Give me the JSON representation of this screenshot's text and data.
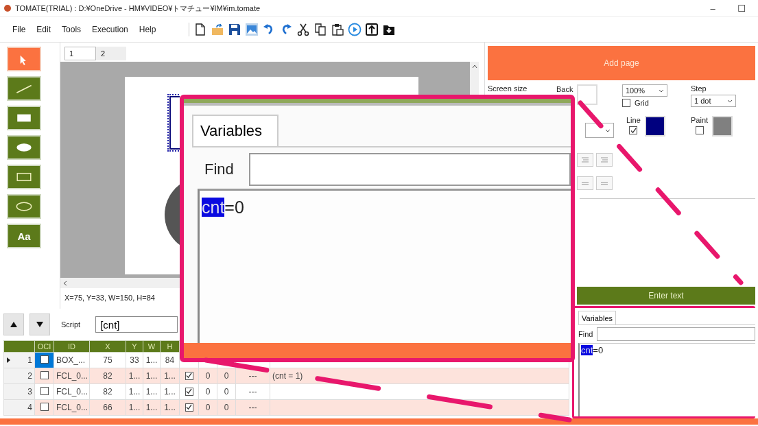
{
  "window": {
    "title": "TOMATE(TRIAL) : D:¥OneDrive - HM¥VIDEO¥トマチュー¥IM¥im.tomate",
    "controls": [
      "–",
      "☐"
    ]
  },
  "menu": [
    "File",
    "Edit",
    "Tools",
    "Execution",
    "Help"
  ],
  "toolbar": [
    {
      "kind": "new"
    },
    {
      "kind": "open"
    },
    {
      "kind": "save"
    },
    {
      "kind": "image"
    },
    {
      "kind": "undo"
    },
    {
      "kind": "redo"
    },
    {
      "kind": "cut"
    },
    {
      "kind": "copy"
    },
    {
      "kind": "paste"
    },
    {
      "kind": "run"
    },
    {
      "kind": "export"
    },
    {
      "kind": "import"
    }
  ],
  "tools": [
    {
      "kind": "pointer",
      "selected": true
    },
    {
      "kind": "line",
      "selected": false
    },
    {
      "kind": "rect",
      "selected": false
    },
    {
      "kind": "ellipse",
      "selected": false
    },
    {
      "kind": "rect-outline",
      "selected": false
    },
    {
      "kind": "ellipse-outline",
      "selected": false
    },
    {
      "kind": "text",
      "label": "Aa",
      "selected": false
    }
  ],
  "page_tabs": [
    {
      "label": "1",
      "selected": true
    },
    {
      "label": "2",
      "selected": false
    }
  ],
  "status": "X=75, Y=33, W=150, H=84",
  "properties": {
    "add_page": "Add page",
    "screen_size": "Screen size",
    "back": {
      "label": "Back",
      "color": "#ffffff"
    },
    "zoom": "100%",
    "grid": {
      "label": "Grid",
      "checked": false
    },
    "step": {
      "label": "Step",
      "value": "1 dot"
    },
    "line": {
      "label": "Line",
      "checked": true,
      "color": "#00007f"
    },
    "paint": {
      "label": "Paint",
      "checked": false,
      "color": "#808080"
    },
    "enter_text": "Enter text"
  },
  "script": {
    "label": "Script",
    "value": "[cnt]"
  },
  "table": {
    "columns": [
      "",
      "OCI",
      "ID",
      "X",
      "Y",
      "W",
      "H"
    ],
    "rows": [
      {
        "current": true,
        "checked": false,
        "selected": true,
        "cells": [
          "1",
          "",
          "BOX_...",
          "75",
          "33",
          "1...",
          "84"
        ]
      },
      {
        "current": false,
        "checked": false,
        "selected": false,
        "cells": [
          "2",
          "",
          "FCL_0...",
          "82",
          "1...",
          "1...",
          "1..."
        ],
        "enabled": true,
        "rest": [
          "0",
          "0",
          "---"
        ],
        "script": "(cnt = 1)"
      },
      {
        "current": false,
        "checked": false,
        "selected": false,
        "cells": [
          "3",
          "",
          "FCL_0...",
          "82",
          "1...",
          "1...",
          "1..."
        ],
        "enabled": true,
        "rest": [
          "0",
          "0",
          "---"
        ]
      },
      {
        "current": false,
        "checked": false,
        "selected": false,
        "cells": [
          "4",
          "",
          "FCL_0...",
          "66",
          "1...",
          "1...",
          "1..."
        ],
        "enabled": true,
        "rest": [
          "0",
          "0",
          "---"
        ]
      }
    ]
  },
  "variables": {
    "tab": "Variables",
    "find": "Find",
    "lines": [
      {
        "name": "cnt",
        "value": "=0",
        "selected": true
      }
    ]
  },
  "callout": {
    "tab": "Variables",
    "find": "Find",
    "lines": [
      {
        "name": "cnt",
        "value": "=0",
        "selected": true
      }
    ]
  }
}
